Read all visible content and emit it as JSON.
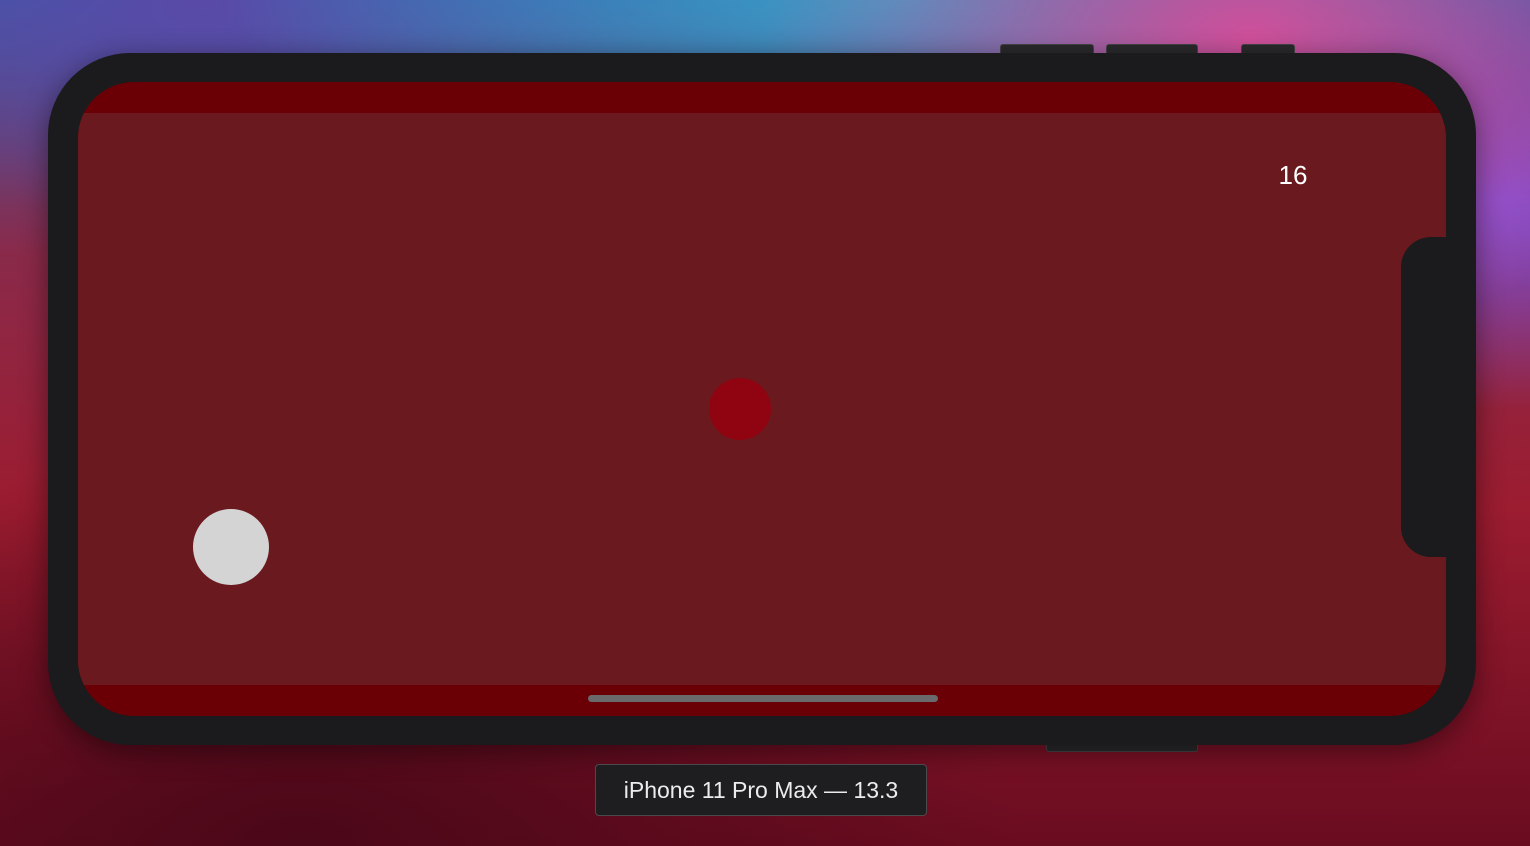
{
  "simulator": {
    "device_label": "iPhone 11 Pro Max — 13.3"
  },
  "game": {
    "score": "16"
  },
  "colors": {
    "screen_background": "#6a1a1e",
    "safe_area_bands": "#6a0005",
    "player_ball": "#d4d4d4",
    "target_ball": "#8f0410",
    "device_frame": "#1b1b1d",
    "score_text": "#ffffff"
  }
}
